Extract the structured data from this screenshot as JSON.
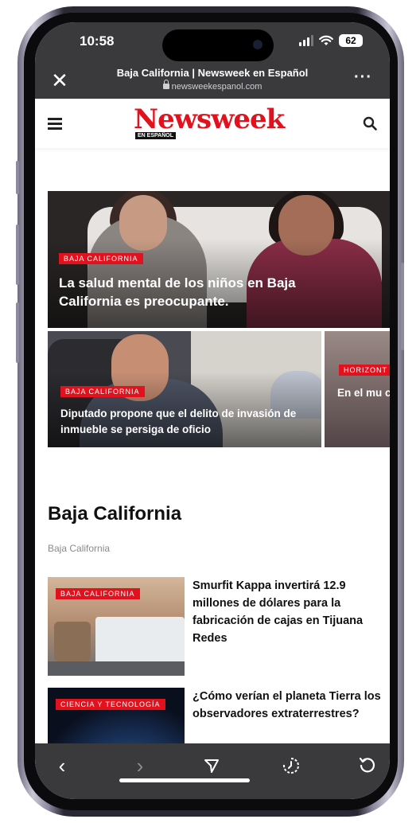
{
  "status_bar": {
    "time": "10:58",
    "battery": "62"
  },
  "browser": {
    "page_title": "Baja California | Newsweek en Español",
    "url": "newsweekespanol.com"
  },
  "site": {
    "logo": "Newsweek",
    "logo_sub": "EN ESPAÑOL"
  },
  "hero": {
    "tag": "BAJA CALIFORNIA",
    "title": "La salud mental de los niños en Baja California es preocupante."
  },
  "cards": [
    {
      "tag": "BAJA CALIFORNIA",
      "title": "Diputado propone que el delito de invasión de inmueble se persiga de oficio"
    },
    {
      "tag": "HORIZONT",
      "title": "En el mu con fístu fetal"
    }
  ],
  "section": {
    "title": "Baja California",
    "breadcrumb": "Baja California"
  },
  "articles": [
    {
      "tag": "BAJA CALIFORNIA",
      "title": "Smurfit Kappa invertirá 12.9 millones de dólares para la fabricación de cajas en Tijuana Redes"
    },
    {
      "tag": "CIENCIA Y TECNOLOGÍA",
      "title": "¿Cómo verían el planeta Tierra los observadores extraterrestres?"
    }
  ],
  "colors": {
    "brand_red": "#e1121e",
    "browser_chrome": "#3a3a3c"
  },
  "icons": [
    "close-icon",
    "more-icon",
    "menu-icon",
    "search-icon",
    "back-icon",
    "forward-icon",
    "share-icon",
    "history-icon",
    "reload-icon"
  ]
}
